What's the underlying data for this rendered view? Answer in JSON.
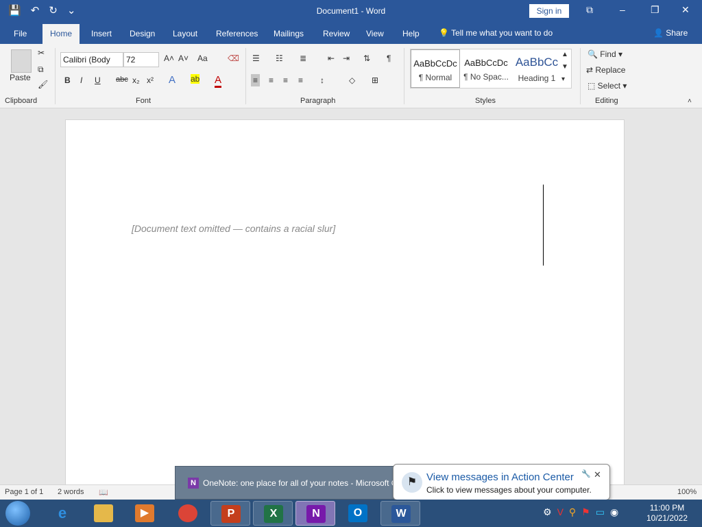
{
  "window": {
    "title": "Document1 - Word",
    "sign_in": "Sign in",
    "minimize": "–",
    "restore": "❐",
    "close": "✕",
    "ribbon_display": "⧉"
  },
  "qat": {
    "save": "💾",
    "undo": "↶",
    "redo": "↻",
    "customize": "⌄"
  },
  "tabs": [
    {
      "label": "File"
    },
    {
      "label": "Home"
    },
    {
      "label": "Insert"
    },
    {
      "label": "Design"
    },
    {
      "label": "Layout"
    },
    {
      "label": "References"
    },
    {
      "label": "Mailings"
    },
    {
      "label": "Review"
    },
    {
      "label": "View"
    },
    {
      "label": "Help"
    }
  ],
  "tell_me": "Tell me what you want to do",
  "share": "Share",
  "clipboard": {
    "paste_label": "Paste",
    "group_label": "Clipboard"
  },
  "font": {
    "name": "Calibri (Body",
    "size": "72",
    "group_label": "Font",
    "change_case": "Aa"
  },
  "paragraph": {
    "group_label": "Paragraph"
  },
  "styles": {
    "group_label": "Styles",
    "items": [
      {
        "preview": "AaBbCcDc",
        "name": "¶ Normal"
      },
      {
        "preview": "AaBbCcDc",
        "name": "¶ No Spac..."
      },
      {
        "preview": "AaBbCc",
        "name": "Heading 1"
      }
    ]
  },
  "editing": {
    "find": "Find",
    "replace": "Replace",
    "select": "Select",
    "group_label": "Editing"
  },
  "document": {
    "body_text": "",
    "omission_note": "[Document text omitted — contains a racial slur]"
  },
  "status": {
    "page": "Page 1 of 1",
    "words": "2 words",
    "zoom": "100%"
  },
  "onenote_popup": {
    "text": "OneNote: one place for all of your notes - Microsoft O"
  },
  "balloon": {
    "title": "View messages in Action Center",
    "subtitle": "Click to view messages about your computer."
  },
  "clock": {
    "time": "11:00 PM",
    "date": "10/21/2022"
  },
  "colors": {
    "word_blue": "#2b579a",
    "taskbar": "#2a4f7a"
  }
}
